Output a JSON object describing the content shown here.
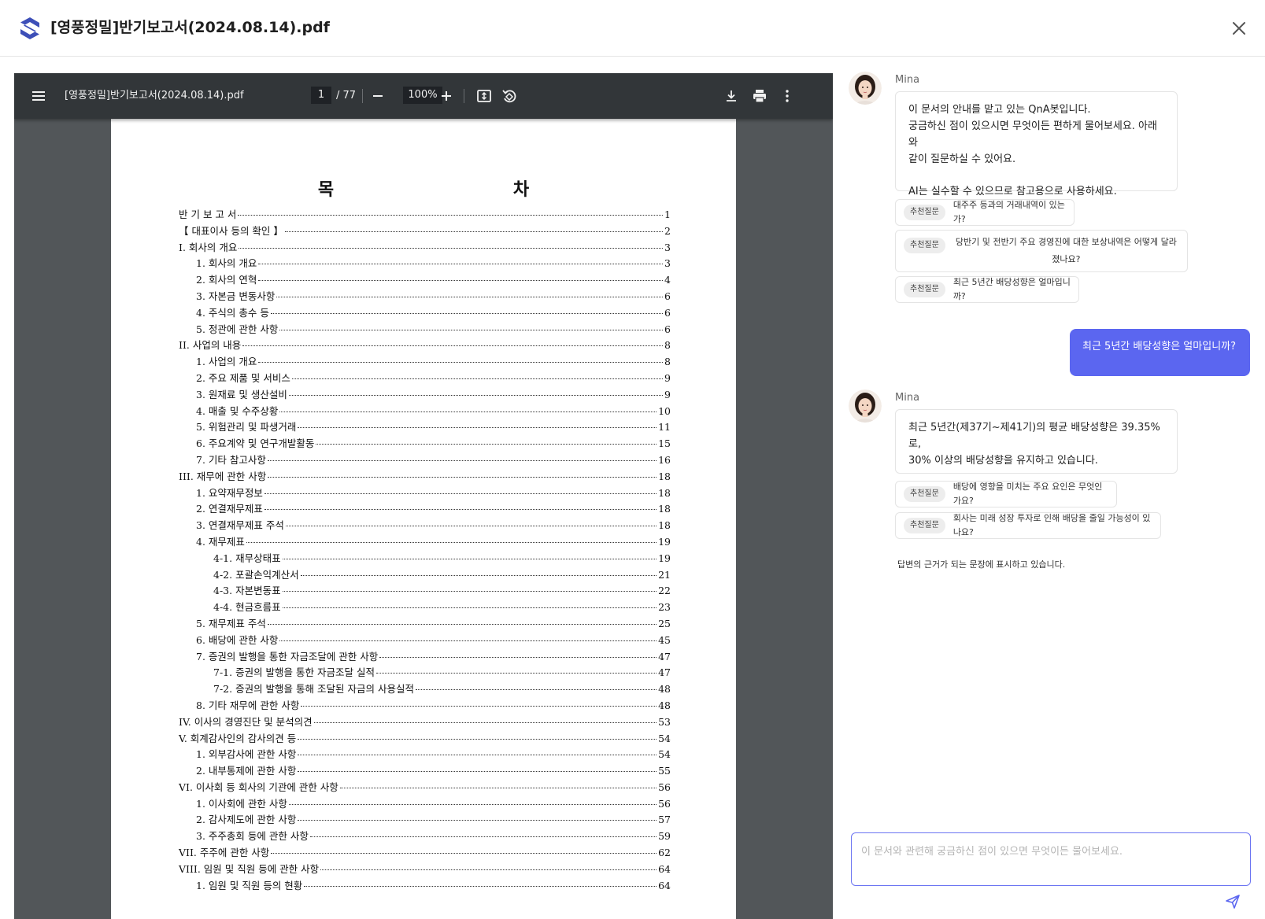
{
  "header": {
    "title": "[영풍정밀]반기보고서(2024.08.14).pdf"
  },
  "viewer": {
    "file_name": "[영풍정밀]반기보고서(2024.08.14).pdf",
    "current_page": "1",
    "total_pages": "/ 77",
    "zoom": "100%"
  },
  "toc": {
    "title": "목 차",
    "items": [
      {
        "label": "반 기 보 고 서",
        "page": "1",
        "level": 0
      },
      {
        "label": "【 대표이사 등의 확인 】",
        "page": "2",
        "level": 0
      },
      {
        "label": "I. 회사의 개요",
        "page": "3",
        "level": 0
      },
      {
        "label": "1. 회사의 개요",
        "page": "3",
        "level": 1
      },
      {
        "label": "2. 회사의 연혁",
        "page": "4",
        "level": 1
      },
      {
        "label": "3. 자본금 변동사항",
        "page": "6",
        "level": 1
      },
      {
        "label": "4. 주식의 총수 등",
        "page": "6",
        "level": 1
      },
      {
        "label": "5. 정관에 관한 사항",
        "page": "6",
        "level": 1
      },
      {
        "label": "II. 사업의 내용",
        "page": "8",
        "level": 0
      },
      {
        "label": "1. 사업의 개요",
        "page": "8",
        "level": 1
      },
      {
        "label": "2. 주요 제품 및 서비스",
        "page": "9",
        "level": 1
      },
      {
        "label": "3. 원재료 및 생산설비",
        "page": "9",
        "level": 1
      },
      {
        "label": "4. 매출 및 수주상황",
        "page": "10",
        "level": 1
      },
      {
        "label": "5. 위험관리 및 파생거래",
        "page": "11",
        "level": 1
      },
      {
        "label": "6. 주요계약 및 연구개발활동",
        "page": "15",
        "level": 1
      },
      {
        "label": "7. 기타 참고사항",
        "page": "16",
        "level": 1
      },
      {
        "label": "III. 재무에 관한 사항",
        "page": "18",
        "level": 0
      },
      {
        "label": "1. 요약재무정보",
        "page": "18",
        "level": 1
      },
      {
        "label": "2. 연결재무제표",
        "page": "18",
        "level": 1
      },
      {
        "label": "3. 연결재무제표 주석",
        "page": "18",
        "level": 1
      },
      {
        "label": "4. 재무제표",
        "page": "19",
        "level": 1
      },
      {
        "label": "4-1. 재무상태표",
        "page": "19",
        "level": 2
      },
      {
        "label": "4-2. 포괄손익계산서",
        "page": "21",
        "level": 2
      },
      {
        "label": "4-3. 자본변동표",
        "page": "22",
        "level": 2
      },
      {
        "label": "4-4. 현금흐름표",
        "page": "23",
        "level": 2
      },
      {
        "label": "5. 재무제표 주석",
        "page": "25",
        "level": 1
      },
      {
        "label": "6. 배당에 관한 사항",
        "page": "45",
        "level": 1
      },
      {
        "label": "7. 증권의 발행을 통한 자금조달에 관한 사항",
        "page": "47",
        "level": 1
      },
      {
        "label": "7-1. 증권의 발행을 통한 자금조달 실적",
        "page": "47",
        "level": 2
      },
      {
        "label": "7-2. 증권의 발행을 통해 조달된 자금의 사용실적",
        "page": "48",
        "level": 2
      },
      {
        "label": "8. 기타 재무에 관한 사항",
        "page": "48",
        "level": 1
      },
      {
        "label": "IV. 이사의 경영진단 및 분석의견",
        "page": "53",
        "level": 0
      },
      {
        "label": "V. 회계감사인의 감사의견 등",
        "page": "54",
        "level": 0
      },
      {
        "label": "1. 외부감사에 관한 사항",
        "page": "54",
        "level": 1
      },
      {
        "label": "2. 내부통제에 관한 사항",
        "page": "55",
        "level": 1
      },
      {
        "label": "VI. 이사회 등 회사의 기관에 관한 사항",
        "page": "56",
        "level": 0
      },
      {
        "label": "1. 이사회에 관한 사항",
        "page": "56",
        "level": 1
      },
      {
        "label": "2. 감사제도에 관한 사항",
        "page": "57",
        "level": 1
      },
      {
        "label": "3. 주주총회 등에 관한 사항",
        "page": "59",
        "level": 1
      },
      {
        "label": "VII. 주주에 관한 사항",
        "page": "62",
        "level": 0
      },
      {
        "label": "VIII. 임원 및 직원 등에 관한 사항",
        "page": "64",
        "level": 0
      },
      {
        "label": "1. 임원 및 직원 등의 현황",
        "page": "64",
        "level": 1
      }
    ]
  },
  "chat": {
    "bot_name": "Mina",
    "welcome": {
      "line1": "이 문서의 안내를 맡고 있는 QnA봇입니다.",
      "line2": "궁금하신 점이 있으시면 무엇이든 편하게 물어보세요. 아래와",
      "line3": "같이 질문하실 수 있어요.",
      "line4": "AI는 실수할 수 있으므로 참고용으로 사용하세요."
    },
    "chip_tag": "추천질문",
    "suggestions1": [
      "대주주 등과의 거래내역이 있는가?",
      "당반기 및 전반기 주요 경영진에 대한 보상내역은 어떻게 달라졌나요?",
      "최근 5년간 배당성향은 얼마입니까?"
    ],
    "user_message": "최근 5년간 배당성향은 얼마입니까?",
    "answer": {
      "line1": "최근 5년간(제37기~제41기)의 평균 배당성향은 39.35%로,",
      "line2": "30% 이상의 배당성향을 유지하고 있습니다."
    },
    "suggestions2": [
      "배당에 영향을 미치는 주요 요인은 무엇인가요?",
      "회사는 미래 성장 투자로 인해 배당을 줄일 가능성이 있나요?"
    ],
    "note": "답변의 근거가 되는 문장에 표시하고 있습니다.",
    "input_placeholder": "이 문서와 관련해 궁금하신 점이 있으면 무엇이든 물어보세요."
  },
  "colors": {
    "accent": "#5b66f0",
    "toolbar": "#323639",
    "viewer_bg": "#525659"
  }
}
